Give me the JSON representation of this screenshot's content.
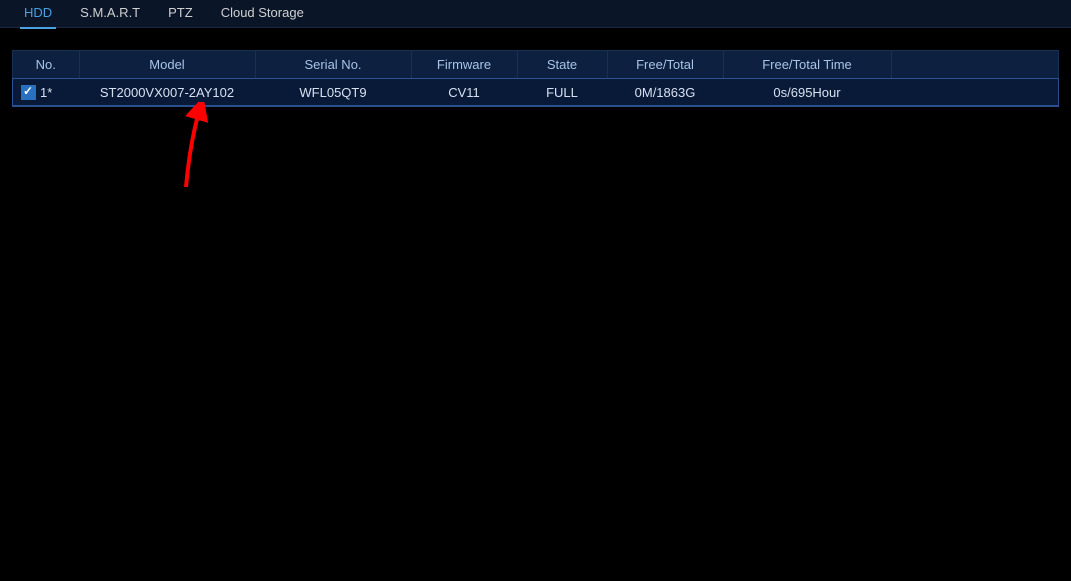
{
  "tabs": [
    {
      "label": "HDD",
      "active": true
    },
    {
      "label": "S.M.A.R.T",
      "active": false
    },
    {
      "label": "PTZ",
      "active": false
    },
    {
      "label": "Cloud Storage",
      "active": false
    }
  ],
  "table": {
    "headers": {
      "no": "No.",
      "model": "Model",
      "serial": "Serial No.",
      "firmware": "Firmware",
      "state": "State",
      "free_total": "Free/Total",
      "free_total_time": "Free/Total Time"
    },
    "rows": [
      {
        "checked": true,
        "no": "1*",
        "model": "ST2000VX007-2AY102",
        "serial": "WFL05QT9",
        "firmware": "CV11",
        "state": "FULL",
        "free_total": "0M/1863G",
        "free_total_time": "0s/695Hour"
      }
    ]
  }
}
